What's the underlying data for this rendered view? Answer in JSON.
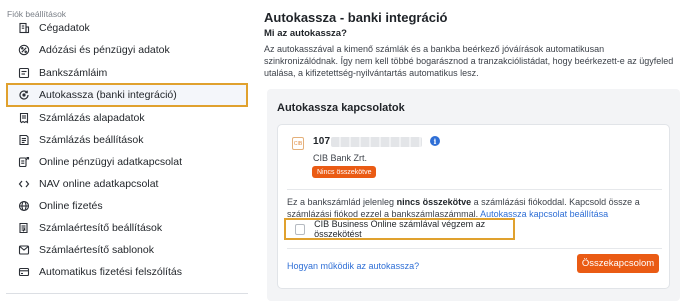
{
  "sidebar": {
    "heading": "Fiók beállítások",
    "items": [
      {
        "label": "Cégadatok",
        "icon": "company-icon"
      },
      {
        "label": "Adózási és pénzügyi adatok",
        "icon": "tax-icon"
      },
      {
        "label": "Bankszámláim",
        "icon": "bank-account-icon"
      },
      {
        "label": "Autokassza (banki integráció)",
        "icon": "sync-icon",
        "active": true
      },
      {
        "label": "Számlázás alapadatok",
        "icon": "invoice-icon"
      },
      {
        "label": "Számlázás beállítások",
        "icon": "invoice-settings-icon"
      },
      {
        "label": "Online pénzügyi adatkapcsolat",
        "icon": "online-finance-icon"
      },
      {
        "label": "NAV online adatkapcsolat",
        "icon": "connection-icon"
      },
      {
        "label": "Online fizetés",
        "icon": "globe-icon"
      },
      {
        "label": "Számlaértesítő beállítások",
        "icon": "notification-settings-icon"
      },
      {
        "label": "Számlaértesítő sablonok",
        "icon": "template-icon"
      },
      {
        "label": "Automatikus fizetési felszólítás",
        "icon": "reminder-icon"
      }
    ]
  },
  "main": {
    "title": "Autokassza - banki integráció",
    "subheading": "Mi az autokassza?",
    "description": "Az autokasszával a kimenő számlák és a bankba beérkező jóváírások automatikusan szinkronizálódnak. Így nem kell többé bogarásznod a tranzakciólistádat, hogy beérkezett-e az ügyfeled utalása, a kifizetettség-nyilvántartás automatikus lesz.",
    "panel_title": "Autokassza kapcsolatok",
    "card": {
      "logo_text": "CIB",
      "account_prefix": "107",
      "bank_name": "CIB Bank Zrt.",
      "status": "Nincs összekötve",
      "text_before": "Ez a bankszámlád jelenleg ",
      "text_bold": "nincs összekötve",
      "text_after": " a számlázási fiókoddal. Kapcsold össze a számlázási fiókod ezzel a bankszámlaszámmal. ",
      "settings_link": "Autokassza kapcsolat beállítása",
      "checkbox_label": "CIB Business Online számlával végzem az összekötést",
      "help_link": "Hogyan működik az autokassza?",
      "connect_button": "Összekapcsolom"
    }
  },
  "colors": {
    "accent": "#ea5b14",
    "highlight": "#e0a12e",
    "link": "#2f6fd6"
  }
}
